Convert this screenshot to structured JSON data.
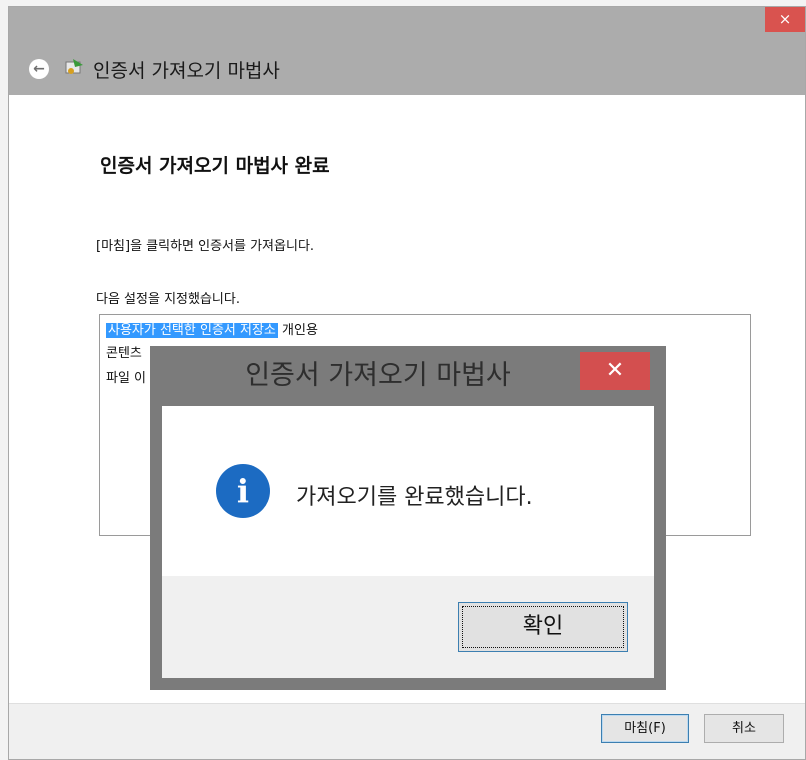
{
  "wizard": {
    "title": "인증서 가져오기 마법사",
    "close_glyph": "×",
    "back_glyph": "←",
    "heading": "인증서 가져오기 마법사 완료",
    "instruction": "[마침]을 클릭하면 인증서를 가져옵니다.",
    "settings_label": "다음 설정을 지정했습니다.",
    "settings_rows": [
      {
        "key": "사용자가 선택한 인증서 저장소",
        "value": "개인용"
      },
      {
        "key": "콘텐츠",
        "value": ""
      },
      {
        "key": "파일 이",
        "value": ""
      }
    ],
    "finish_label": "마침(F)",
    "cancel_label": "취소"
  },
  "dialog": {
    "title": "인증서 가져오기 마법사",
    "close_glyph": "✕",
    "message": "가져오기를 완료했습니다.",
    "info_glyph": "i",
    "ok_label": "확인"
  },
  "colors": {
    "header": "#acacac",
    "close": "#d9534f",
    "highlight": "#3399ff",
    "info": "#1c6bc2"
  }
}
